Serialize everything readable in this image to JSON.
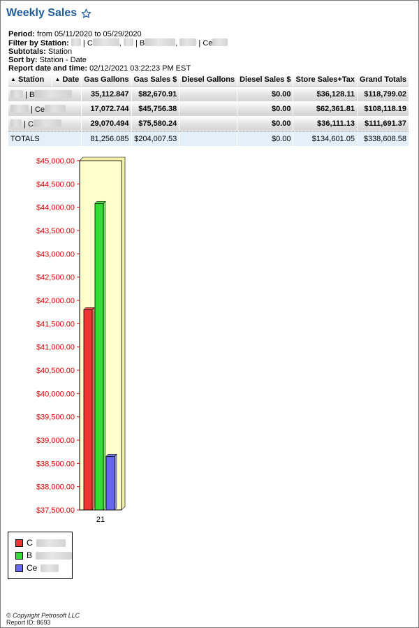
{
  "header": {
    "title": "Weekly Sales",
    "star_icon": "star-outline-icon"
  },
  "meta": {
    "period_label": "Period:",
    "period_value": "from 05/11/2020 to 05/29/2020",
    "filter_label": "Filter by Station:",
    "filter_parts": [
      "| C",
      ", ",
      "| B",
      ", ",
      "| Ce"
    ],
    "subtotals_label": "Subtotals:",
    "subtotals_value": "Station",
    "sort_label": "Sort by:",
    "sort_value": "Station - Date",
    "report_label": "Report date and time:",
    "report_value": "02/12/2021 03:22:23 PM EST"
  },
  "table": {
    "columns": [
      "Station",
      "Date",
      "Gas Gallons",
      "Gas Sales $",
      "Diesel Gallons",
      "Diesel Sales $",
      "Store Sales+Tax",
      "Grand Totals"
    ],
    "rows": [
      {
        "station": "| B",
        "gas_gallons": "35,112.847",
        "gas_sales": "$82,670.91",
        "diesel_gallons": "",
        "diesel_sales": "$0.00",
        "store_sales": "$36,128.11",
        "grand_totals": "$118,799.02"
      },
      {
        "station": "| Ce",
        "gas_gallons": "17,072.744",
        "gas_sales": "$45,756.38",
        "diesel_gallons": "",
        "diesel_sales": "$0.00",
        "store_sales": "$62,361.81",
        "grand_totals": "$108,118.19"
      },
      {
        "station": "| C",
        "gas_gallons": "29,070.494",
        "gas_sales": "$75,580.24",
        "diesel_gallons": "",
        "diesel_sales": "$0.00",
        "store_sales": "$36,111.13",
        "grand_totals": "$111,691.37"
      }
    ],
    "totals": {
      "label": "TOTALS",
      "gas_gallons": "81,256.085",
      "gas_sales": "$204,007.53",
      "diesel_gallons": "",
      "diesel_sales": "$0.00",
      "store_sales": "$134,601.05",
      "grand_totals": "$338,608.58"
    }
  },
  "chart_data": {
    "type": "bar",
    "categories": [
      "21"
    ],
    "series": [
      {
        "name": "C",
        "values": [
          41800
        ],
        "color": "#ee3333"
      },
      {
        "name": "B",
        "values": [
          44080
        ],
        "color": "#33dd33"
      },
      {
        "name": "Ce",
        "values": [
          38650
        ],
        "color": "#6666ee"
      }
    ],
    "ylim": [
      37500,
      45000
    ],
    "yticks": [
      "$45,000.00",
      "$44,500.00",
      "$44,000.00",
      "$43,500.00",
      "$43,000.00",
      "$42,500.00",
      "$42,000.00",
      "$41,500.00",
      "$41,000.00",
      "$40,500.00",
      "$40,000.00",
      "$39,500.00",
      "$39,000.00",
      "$38,500.00",
      "$38,000.00",
      "$37,500.00"
    ],
    "ytick_color": "#dd0000",
    "plot_bg": "#ffffcc",
    "grid": false,
    "legend_placement": "bottom-left"
  },
  "footer": {
    "copyright": "© Copyright Petrosoft LLC",
    "report_id": "Report ID: 8693"
  }
}
